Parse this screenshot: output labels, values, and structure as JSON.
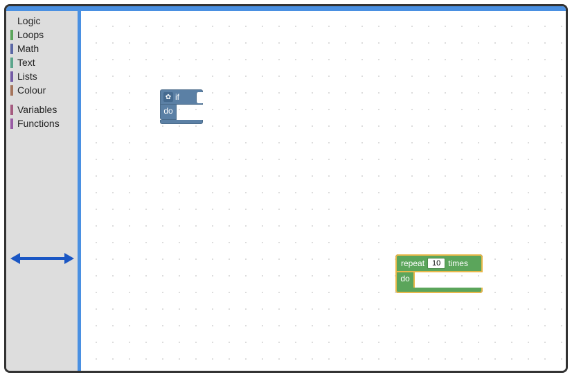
{
  "toolbox": {
    "categories": [
      {
        "label": "Logic",
        "color": "#5b80a5"
      },
      {
        "label": "Loops",
        "color": "#5ba55b"
      },
      {
        "label": "Math",
        "color": "#5b67a5"
      },
      {
        "label": "Text",
        "color": "#5ba58c"
      },
      {
        "label": "Lists",
        "color": "#745ba5"
      },
      {
        "label": "Colour",
        "color": "#a5745b"
      }
    ],
    "extras": [
      {
        "label": "Variables",
        "color": "#a55b80"
      },
      {
        "label": "Functions",
        "color": "#995ba5"
      }
    ]
  },
  "blocks": {
    "if_block": {
      "keyword_if": "if",
      "keyword_do": "do",
      "gear": "✿"
    },
    "repeat_block": {
      "keyword_repeat": "repeat",
      "keyword_times": "times",
      "keyword_do": "do",
      "count": "10"
    }
  }
}
